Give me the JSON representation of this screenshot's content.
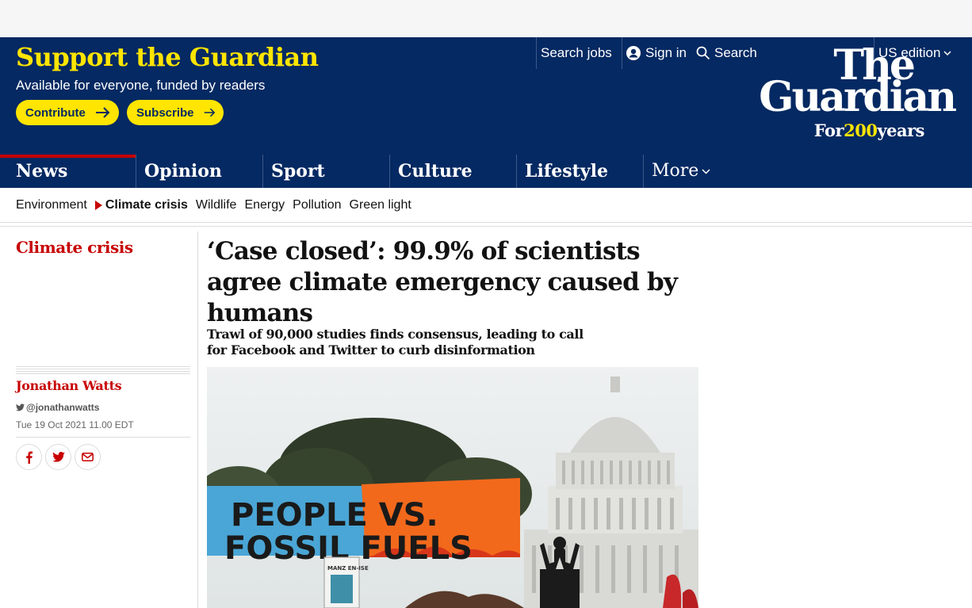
{
  "masthead": {
    "support_title": "Support the Guardian",
    "support_sub": "Available for everyone, funded by readers",
    "contribute_label": "Contribute",
    "subscribe_label": "Subscribe",
    "search_jobs": "Search jobs",
    "sign_in": "Sign in",
    "search": "Search",
    "edition": "US edition",
    "logo_the": "The",
    "logo_guardian": "Guardian",
    "logo_for": "For",
    "logo_200": "200",
    "logo_years": "years"
  },
  "pillars": [
    {
      "label": "News",
      "active": true
    },
    {
      "label": "Opinion",
      "active": false
    },
    {
      "label": "Sport",
      "active": false
    },
    {
      "label": "Culture",
      "active": false
    },
    {
      "label": "Lifestyle",
      "active": false
    }
  ],
  "more_label": "More",
  "subnav": {
    "items": [
      "Environment",
      "Climate crisis",
      "Wildlife",
      "Energy",
      "Pollution",
      "Green light"
    ],
    "current_index": 1
  },
  "article": {
    "section": "Climate crisis",
    "author": "Jonathan Watts",
    "twitter": "@jonathanwatts",
    "date": "Tue 19 Oct 2021 11.00 EDT",
    "headline": "‘Case closed’: 99.9% of scientists agree climate emergency caused by humans",
    "standfirst": "Trawl of 90,000 studies finds consensus, leading to call for Facebook and Twitter to curb disinformation",
    "photo": {
      "banner_line1": "PEOPLE VS.",
      "banner_line2": "FOSSIL FUELS",
      "sign_text": "MANZ EN-ISE"
    }
  },
  "colors": {
    "brand_blue": "#052962",
    "brand_yellow": "#ffe500",
    "news_red": "#c70000"
  },
  "icons": [
    "arrow-right-icon",
    "account-icon",
    "search-icon",
    "chevron-down-icon",
    "twitter-icon",
    "facebook-icon",
    "email-icon"
  ]
}
